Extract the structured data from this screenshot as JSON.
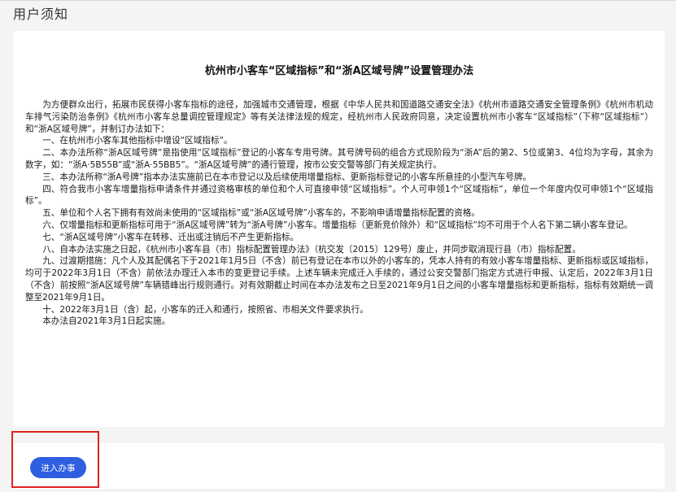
{
  "header": {
    "title": "用户须知"
  },
  "document": {
    "title": "杭州市小客车“区域指标”和“浙A区域号牌”设置管理办法",
    "paragraphs": [
      "为方便群众出行，拓展市民获得小客车指标的途径，加强城市交通管理，根据《中华人民共和国道路交通安全法》《杭州市道路交通安全管理条例》《杭州市机动车排气污染防治条例》《杭州市小客车总量调控管理规定》等有关法律法规的规定，经杭州市人民政府同意，决定设置杭州市小客车“区域指标”（下称“区域指标”）和“浙A区域号牌”，并制订办法如下：",
      "一、在杭州市小客车其他指标中增设“区域指标”。",
      "二、本办法所称“浙A区域号牌”是指使用“区域指标”登记的小客车专用号牌。其号牌号码的组合方式现阶段为“浙A”后的第2、5位或第3、4位均为字母，其余为数字，如：“浙A·5B55B”或“浙A·55BB5”。“浙A区域号牌”的通行管理，按市公安交警等部门有关规定执行。",
      "三、本办法所称“浙A号牌”指本办法实施前已在本市登记以及后续使用增量指标、更新指标登记的小客车所悬挂的小型汽车号牌。",
      "四、符合我市小客车增量指标申请条件并通过资格审核的单位和个人可直接申领“区域指标”。个人可申领1个“区域指标”，单位一个年度内仅可申领1个“区域指标”。",
      "五、单位和个人名下拥有有效尚未使用的“区域指标”或“浙A区域号牌”小客车的，不影响申请增量指标配置的资格。",
      "六、仅增量指标和更新指标可用于“浙A区域号牌”转为“浙A号牌”小客车。增量指标（更新竞价除外）和“区域指标”均不可用于个人名下第二辆小客车登记。",
      "七、“浙A区域号牌”小客车在转移、迁出或注销后不产生更新指标。",
      "八、自本办法实施之日起，《杭州市小客车县（市）指标配置管理办法》（杭交发〔2015〕129号）废止，并同步取消现行县（市）指标配置。",
      "九、过渡期措施：凡个人及其配偶名下于2021年1月5日（不含）前已有登记在本市以外的小客车的，凭本人持有的有效小客车增量指标、更新指标或区域指标，均可于2022年3月1日（不含）前依法办理迁入本市的变更登记手续。上述车辆未完成迁入手续的，通过公安交警部门指定方式进行申报、认定后，2022年3月1日（不含）前按照“浙A区域号牌”车辆错峰出行规则通行。对有效期截止时间在本办法发布之日至2021年9月1日之间的小客车增量指标和更新指标，指标有效期统一调整至2021年9月1日。",
      "十、2022年3月1日（含）起，小客车的迁入和通行，按照省、市相关文件要求执行。",
      "本办法自2021年3月1日起实施。"
    ]
  },
  "actions": {
    "enter_label": "进入办事"
  },
  "colors": {
    "page_background": "#f4f4f5",
    "card_background": "#ffffff",
    "button_primary": "#2f5fe0",
    "highlight_border": "#e0231f"
  }
}
